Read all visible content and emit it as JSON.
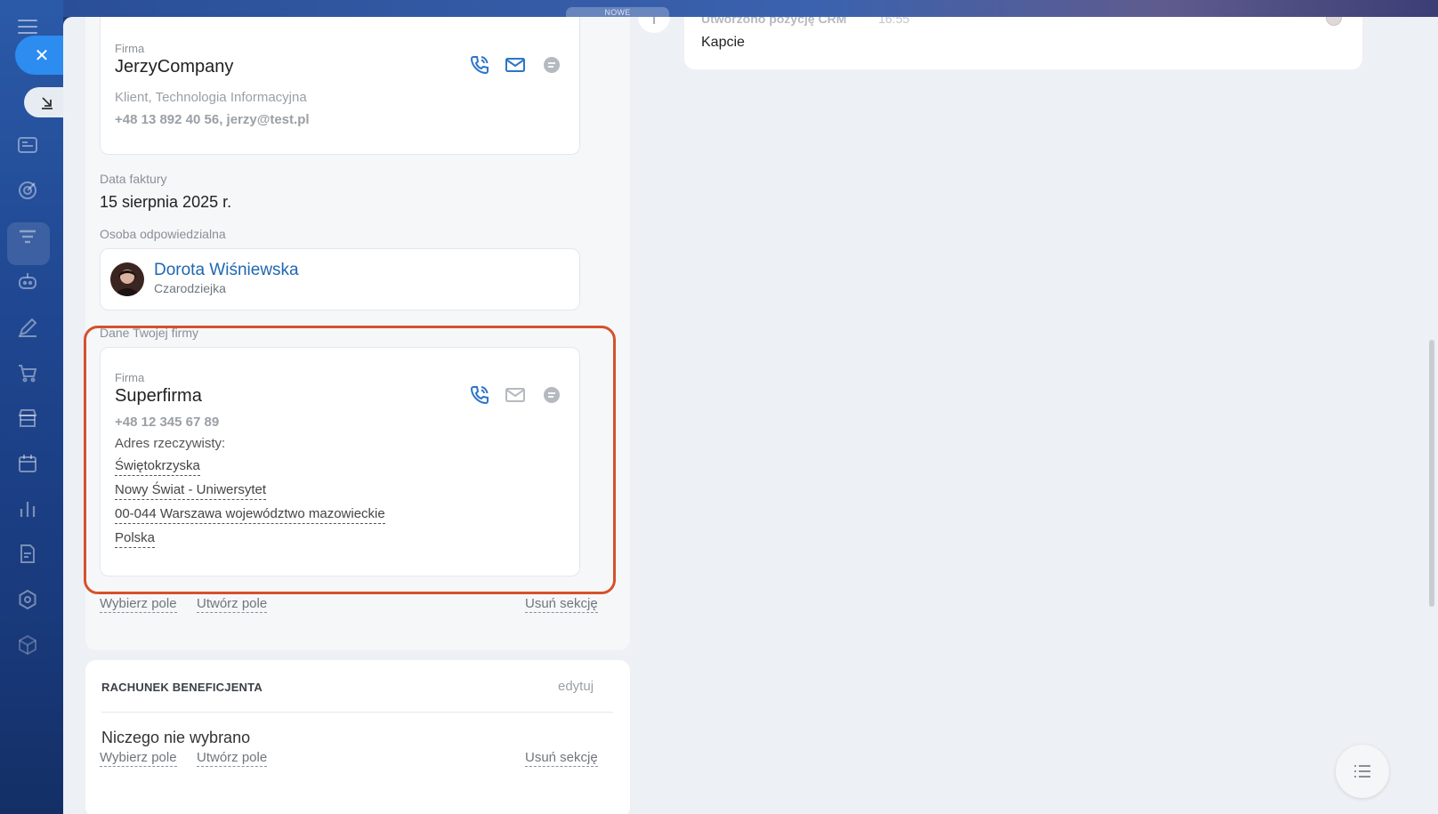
{
  "top": {
    "new_tab_label": "NOWE"
  },
  "client_card": {
    "type_label": "Firma",
    "name": "JerzyCompany",
    "meta_line": "Klient, Technologia Informacyjna",
    "contact_line": "+48 13 892 40 56, jerzy@test.pl"
  },
  "invoice_date": {
    "label": "Data faktury",
    "value": "15 sierpnia 2025 r."
  },
  "responsible": {
    "label": "Osoba odpowiedzialna",
    "name": "Dorota Wiśniewska",
    "role": "Czarodziejka"
  },
  "my_company": {
    "section_label": "Dane Twojej firmy",
    "type_label": "Firma",
    "name": "Superfirma",
    "phone": "+48 12 345 67 89",
    "address_label": "Adres rzeczywisty:",
    "address_lines": [
      "Świętokrzyska",
      "Nowy Świat - Uniwersytet",
      "00-044 Warszawa województwo mazowieckie",
      "Polska"
    ]
  },
  "section_actions": {
    "select_field": "Wybierz pole",
    "create_field": "Utwórz pole",
    "delete_section": "Usuń sekcję"
  },
  "beneficiary": {
    "title": "RACHUNEK BENEFICJENTA",
    "edit": "edytuj",
    "empty": "Niczego nie wybrano",
    "select_field": "Wybierz pole",
    "create_field": "Utwórz pole",
    "delete_section": "Usuń sekcję"
  },
  "timeline": {
    "header": "Utworzono pozycję CRM",
    "time": "16:55",
    "text": "Kapcie"
  },
  "icons": [
    "phone-icon",
    "mail-icon",
    "chat-icon",
    "close-icon",
    "collapse-icon",
    "list-icon"
  ],
  "colors": {
    "accent_blue": "#2d8cf0",
    "highlight_orange": "#d6512c",
    "link_blue": "#2067b0"
  }
}
